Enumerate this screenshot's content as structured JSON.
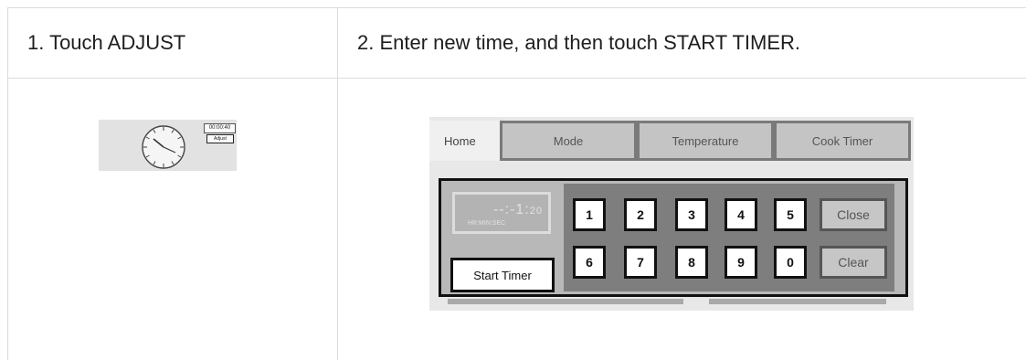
{
  "headers": {
    "step1": "1. Touch ADJUST",
    "step2": "2. Enter new time, and then touch START TIMER."
  },
  "step1_screen": {
    "timer_value": "00:00:40",
    "adjust_label": "Adjust",
    "icon": "clock-icon"
  },
  "step2_screen": {
    "tabs": [
      "Home",
      "Mode",
      "Temperature",
      "Cook Timer"
    ],
    "time_display": {
      "main": "--:-1:",
      "seconds": "20",
      "format": "HR:MIN:SEC"
    },
    "start_timer_label": "Start Timer",
    "keys_row1": [
      "1",
      "2",
      "3",
      "4",
      "5"
    ],
    "keys_row2": [
      "6",
      "7",
      "8",
      "9",
      "0"
    ],
    "close_label": "Close",
    "clear_label": "Clear"
  }
}
